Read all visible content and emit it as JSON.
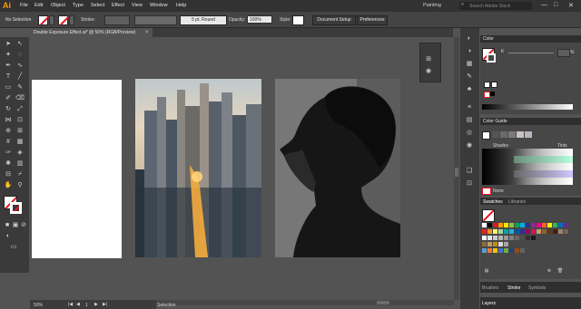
{
  "app": {
    "logo": "Ai",
    "workspace": "Painting",
    "search_placeholder": "Search Adobe Stock"
  },
  "menu": [
    "File",
    "Edit",
    "Object",
    "Type",
    "Select",
    "Effect",
    "View",
    "Window",
    "Help"
  ],
  "window_controls": {
    "minimize": "—",
    "maximize": "□",
    "close": "✕"
  },
  "control": {
    "selection": "No Selection",
    "stroke_label": "Stroke:",
    "brush": "5 pt. Round",
    "opacity_label": "Opacity:",
    "opacity_value": "100%",
    "style_label": "Style:",
    "document_setup": "Document Setup",
    "preferences": "Preferences"
  },
  "document": {
    "tab_title": "Double Exposure Effect.ai* @ 50% (RGB/Preview)",
    "close": "×"
  },
  "status": {
    "zoom": "50%",
    "page": "1",
    "tool": "Selection"
  },
  "panels": {
    "color": "Color",
    "color_k": "K",
    "color_pct": "%",
    "color_guide": "Color Guide",
    "shades": "Shades",
    "tints": "Tints",
    "none": "None",
    "swatches": "Swatches",
    "libraries": "Libraries",
    "brushes": "Brushes",
    "stroke": "Stroke",
    "symbols": "Symbols",
    "layers": "Layers"
  },
  "colors": {
    "ui_dark": "#323232",
    "panel_bg": "#535353",
    "accent_red": "#e3161f",
    "logo_orange": "#ff9a00"
  },
  "icons": [
    "selection-tool-icon",
    "direct-selection-tool-icon",
    "pen-tool-icon",
    "type-tool-icon",
    "rectangle-tool-icon",
    "brush-tool-icon",
    "zoom-tool-icon",
    "hand-tool-icon"
  ]
}
